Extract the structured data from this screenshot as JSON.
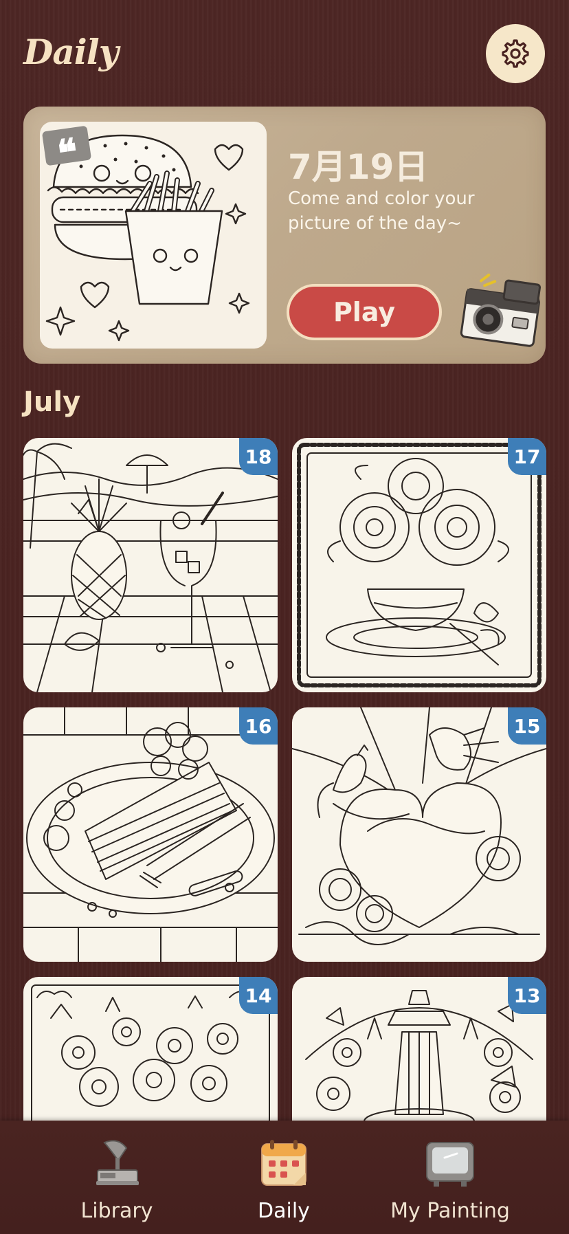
{
  "header": {
    "title": "Daily"
  },
  "hero": {
    "date": "7月19日",
    "subtitle": "Come and color your picture of the day~",
    "play_label": "Play"
  },
  "month_label": "July",
  "cards": [
    {
      "day": "18",
      "picture": "pineapple-cocktail"
    },
    {
      "day": "17",
      "picture": "peony-teacup"
    },
    {
      "day": "16",
      "picture": "berry-cake"
    },
    {
      "day": "15",
      "picture": "birds-heart-roses"
    },
    {
      "day": "14",
      "picture": "flower-bouquet"
    },
    {
      "day": "13",
      "picture": "garden-fountain"
    }
  ],
  "nav": {
    "items": [
      {
        "label": "Library",
        "icon": "gramophone-icon"
      },
      {
        "label": "Daily",
        "icon": "calendar-icon"
      },
      {
        "label": "My Painting",
        "icon": "tv-icon"
      }
    ],
    "active": "Daily"
  },
  "colors": {
    "background": "#4a2321",
    "accent_cream": "#f6e2c2",
    "play_red": "#c94a46",
    "badge_blue": "#3e7eb8"
  }
}
